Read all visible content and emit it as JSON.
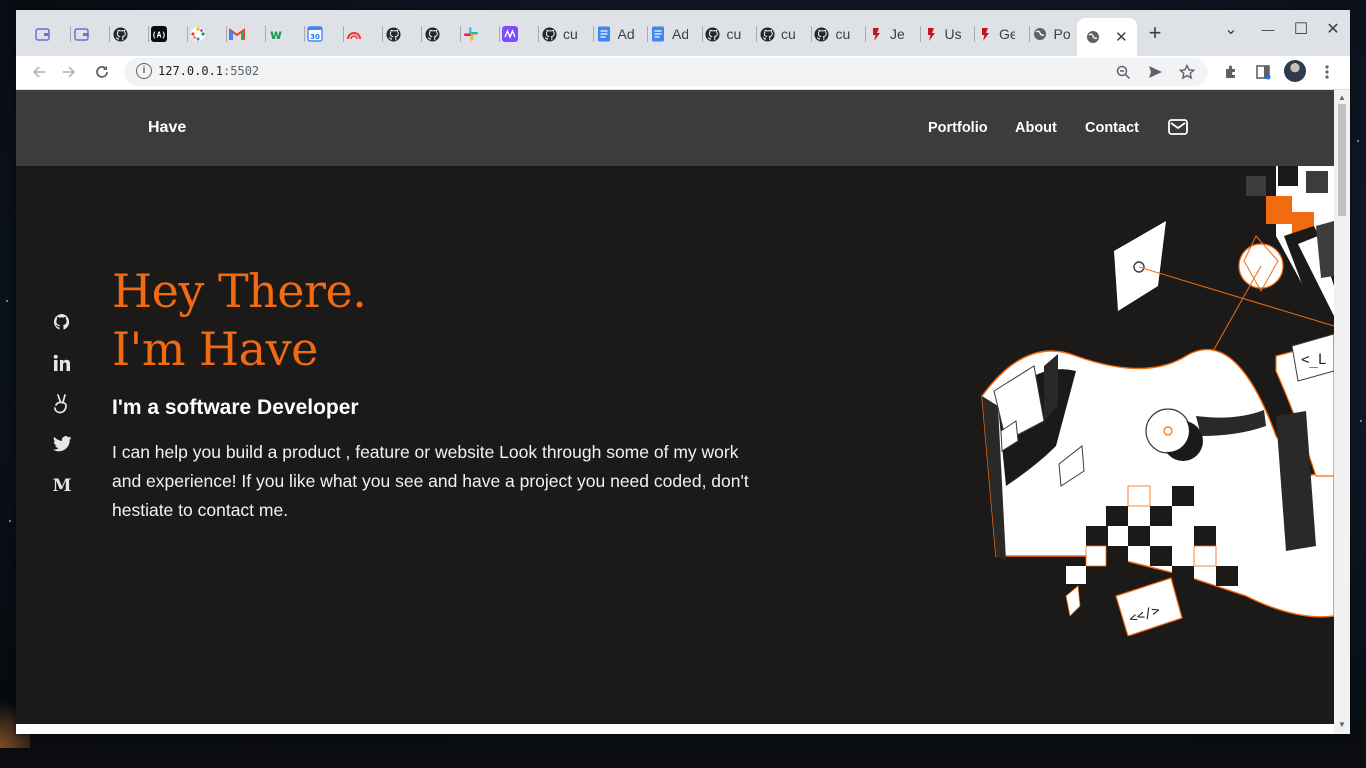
{
  "browser": {
    "tabs": [
      {
        "icon": "wallet-icon",
        "title": ""
      },
      {
        "icon": "wallet-icon",
        "title": ""
      },
      {
        "icon": "github-icon",
        "title": ""
      },
      {
        "icon": "code-brackets-icon",
        "title": ""
      },
      {
        "icon": "color-wheel-icon",
        "title": ""
      },
      {
        "icon": "gmail-icon",
        "title": ""
      },
      {
        "icon": "w-logo-icon",
        "title": ""
      },
      {
        "icon": "calendar-icon",
        "title": ""
      },
      {
        "icon": "gauge-icon",
        "title": ""
      },
      {
        "icon": "github-icon",
        "title": ""
      },
      {
        "icon": "github-icon",
        "title": ""
      },
      {
        "icon": "slack-icon",
        "title": ""
      },
      {
        "icon": "mm-logo-icon",
        "title": ""
      },
      {
        "icon": "github-icon",
        "title": "cu"
      },
      {
        "icon": "docs-icon",
        "title": "Ad"
      },
      {
        "icon": "docs-icon",
        "title": "Ad"
      },
      {
        "icon": "github-icon",
        "title": "cu"
      },
      {
        "icon": "github-icon",
        "title": "cu"
      },
      {
        "icon": "github-icon",
        "title": "cu"
      },
      {
        "icon": "jest-icon",
        "title": "Je"
      },
      {
        "icon": "jest-icon",
        "title": "Us"
      },
      {
        "icon": "jest-icon",
        "title": "Ge"
      },
      {
        "icon": "globe-icon",
        "title": "Po"
      }
    ],
    "active_tab": {
      "icon": "globe-icon",
      "title": "",
      "close": "✕"
    },
    "new_tab": "+",
    "url_host": "127.0.0.1",
    "url_port": ":5502",
    "controls": {
      "minimize": "—",
      "maximize": "☐",
      "close": "✕",
      "tab_search": "⌄"
    }
  },
  "site": {
    "brand": "Have",
    "nav": {
      "portfolio": "Portfolio",
      "about": "About",
      "contact": "Contact"
    },
    "socials": [
      "github-icon",
      "linkedin-icon",
      "angellist-icon",
      "twitter-icon",
      "medium-icon"
    ],
    "hero": {
      "line1": "Hey There.",
      "line2": "I'm Have",
      "subtitle": "I'm a software Developer",
      "body": "I can help you build a product , feature or website Look through some of my work and experience! If you like what you see and have a project you need coded, don't hestiate to contact me."
    },
    "accent_color": "#f26b10",
    "nav_bg": "#3d3c3b",
    "page_bg": "#1b1a19"
  }
}
